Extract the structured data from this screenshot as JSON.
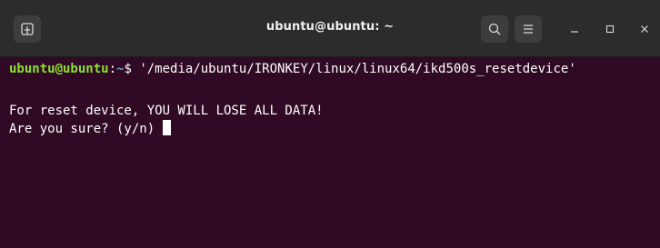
{
  "window": {
    "title": "ubuntu@ubuntu: ~"
  },
  "icons": {
    "new_tab": "new-tab-icon",
    "search": "search-icon",
    "menu": "hamburger-menu-icon",
    "minimize": "minimize-icon",
    "maximize": "maximize-icon",
    "close": "close-icon"
  },
  "terminal": {
    "prompt_user": "ubuntu@ubuntu",
    "prompt_colon": ":",
    "prompt_path": "~",
    "prompt_symbol": "$ ",
    "command": "'/media/ubuntu/IRONKEY/linux/linux64/ikd500s_resetdevice'",
    "output_line1": "For reset device, YOU WILL LOSE ALL DATA!",
    "output_line2": "Are you sure? (y/n) "
  },
  "colors": {
    "background": "#300a24",
    "titlebar": "#2c2c2c",
    "prompt_user": "#8ae234",
    "prompt_path": "#729fcf",
    "text": "#ffffff"
  }
}
